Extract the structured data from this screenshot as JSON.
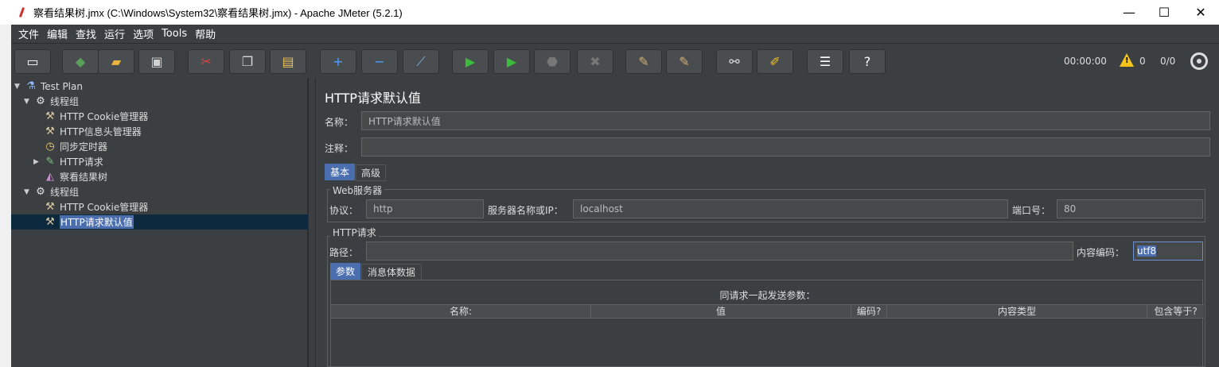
{
  "window": {
    "title": "察看结果树.jmx (C:\\Windows\\System32\\察看结果树.jmx) - Apache JMeter (5.2.1)",
    "minimize": "—",
    "maximize": "☐",
    "close": "✕"
  },
  "menu": [
    "文件",
    "编辑",
    "查找",
    "运行",
    "选项",
    "Tools",
    "帮助"
  ],
  "toolbar": {
    "buttons": [
      {
        "name": "new-icon",
        "glyph": "▭",
        "color": "#ffffff"
      },
      {
        "name": "templates-icon",
        "glyph": "◆",
        "color": "#5aa05a"
      },
      {
        "name": "open-icon",
        "glyph": "▰",
        "color": "#e8b43c"
      },
      {
        "name": "save-icon",
        "glyph": "▣",
        "color": "#d0d0d0"
      },
      {
        "name": "cut-icon",
        "glyph": "✂",
        "color": "#e04040"
      },
      {
        "name": "copy-icon",
        "glyph": "❐",
        "color": "#d8d8d8"
      },
      {
        "name": "paste-icon",
        "glyph": "▤",
        "color": "#e8c060"
      },
      {
        "name": "expand-icon",
        "glyph": "+",
        "color": "#4aa0ff"
      },
      {
        "name": "collapse-icon",
        "glyph": "−",
        "color": "#4aa0ff"
      },
      {
        "name": "toggle-icon",
        "glyph": "⟋",
        "color": "#7fb0e0"
      },
      {
        "name": "start-icon",
        "glyph": "▶",
        "color": "#3cbb3c"
      },
      {
        "name": "start-no-pause-icon",
        "glyph": "▶",
        "color": "#3cbb3c"
      },
      {
        "name": "stop-icon",
        "glyph": "⬣",
        "color": "#777777"
      },
      {
        "name": "shutdown-icon",
        "glyph": "✖",
        "color": "#777777"
      },
      {
        "name": "clear-icon",
        "glyph": "✎",
        "color": "#d0b070"
      },
      {
        "name": "clear-all-icon",
        "glyph": "✎",
        "color": "#d0b070"
      },
      {
        "name": "search-icon",
        "glyph": "⚯",
        "color": "#dddddd"
      },
      {
        "name": "reset-search-icon",
        "glyph": "✐",
        "color": "#f0c020"
      },
      {
        "name": "function-helper-icon",
        "glyph": "☰",
        "color": "#ffffff"
      },
      {
        "name": "help-icon",
        "glyph": "?",
        "color": "#ffffff"
      }
    ],
    "elapsed": "00:00:00",
    "warning_count": "0",
    "threads": "0/0"
  },
  "tree": [
    {
      "label": "Test Plan",
      "level": 0,
      "toggle": "▼",
      "icon": "flask-icon",
      "glyph": "⚗",
      "color": "#8fb7ff"
    },
    {
      "label": "线程组",
      "level": 1,
      "toggle": "▼",
      "icon": "gear-icon",
      "glyph": "⚙",
      "color": "#e0e0e0"
    },
    {
      "label": "HTTP Cookie管理器",
      "level": 2,
      "toggle": "",
      "icon": "wrench-icon",
      "glyph": "⚒",
      "color": "#d8c8a0"
    },
    {
      "label": "HTTP信息头管理器",
      "level": 2,
      "toggle": "",
      "icon": "wrench-icon",
      "glyph": "⚒",
      "color": "#d8c8a0"
    },
    {
      "label": "同步定时器",
      "level": 2,
      "toggle": "",
      "icon": "clock-icon",
      "glyph": "◷",
      "color": "#f0d070"
    },
    {
      "label": "HTTP请求",
      "level": 2,
      "toggle": "▶",
      "icon": "pipette-icon",
      "glyph": "✎",
      "color": "#80c080"
    },
    {
      "label": "察看结果树",
      "level": 2,
      "toggle": "",
      "icon": "chart-icon",
      "glyph": "◭",
      "color": "#c890d0"
    },
    {
      "label": "线程组",
      "level": 1,
      "toggle": "▼",
      "icon": "gear-icon",
      "glyph": "⚙",
      "color": "#e0e0e0"
    },
    {
      "label": "HTTP Cookie管理器",
      "level": 2,
      "toggle": "",
      "icon": "wrench-icon",
      "glyph": "⚒",
      "color": "#d8c8a0"
    },
    {
      "label": "HTTP请求默认值",
      "level": 2,
      "toggle": "",
      "icon": "wrench-icon",
      "glyph": "⚒",
      "color": "#d8c8a0",
      "selected": true
    }
  ],
  "panel": {
    "title": "HTTP请求默认值",
    "name_label": "名称：",
    "name_value": "HTTP请求默认值",
    "comment_label": "注释：",
    "comment_value": "",
    "tabs": [
      "基本",
      "高级"
    ],
    "web_server": {
      "title": "Web服务器",
      "protocol_label": "协议：",
      "protocol_value": "http",
      "server_label": "服务器名称或IP：",
      "server_value": "localhost",
      "port_label": "端口号：",
      "port_value": "80"
    },
    "http_request": {
      "title": "HTTP请求",
      "path_label": "路径：",
      "path_value": "",
      "encoding_label": "内容编码：",
      "encoding_value": "utf8"
    },
    "subtabs": [
      "参数",
      "消息体数据"
    ],
    "params": {
      "caption": "同请求一起发送参数：",
      "columns": [
        "名称:",
        "值",
        "编码?",
        "内容类型",
        "包含等于?"
      ]
    }
  }
}
